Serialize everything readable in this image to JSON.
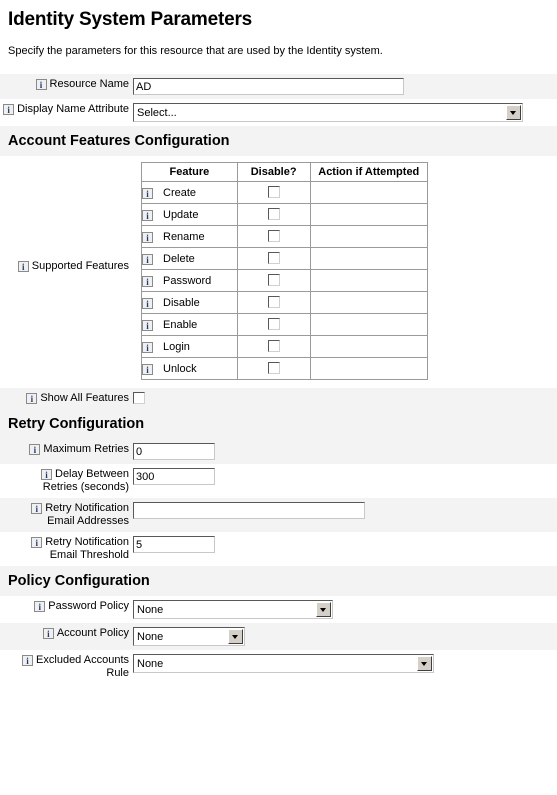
{
  "page": {
    "title": "Identity System Parameters",
    "subtitle": "Specify the parameters for this resource that are used by the Identity system."
  },
  "fields": {
    "resource_name": {
      "label": "Resource Name",
      "value": "AD"
    },
    "display_name_attribute": {
      "label": "Display Name Attribute",
      "value": "Select..."
    },
    "supported_features": {
      "label": "Supported Features"
    },
    "show_all_features": {
      "label": "Show All Features",
      "checked": false
    }
  },
  "sections": {
    "account_features": "Account Features Configuration",
    "retry": "Retry Configuration",
    "policy": "Policy Configuration"
  },
  "features_table": {
    "columns": [
      "Feature",
      "Disable?",
      "Action if Attempted"
    ],
    "rows": [
      {
        "feature": "Create",
        "disabled": false,
        "action": ""
      },
      {
        "feature": "Update",
        "disabled": false,
        "action": ""
      },
      {
        "feature": "Rename",
        "disabled": false,
        "action": ""
      },
      {
        "feature": "Delete",
        "disabled": false,
        "action": ""
      },
      {
        "feature": "Password",
        "disabled": false,
        "action": ""
      },
      {
        "feature": "Disable",
        "disabled": false,
        "action": ""
      },
      {
        "feature": "Enable",
        "disabled": false,
        "action": ""
      },
      {
        "feature": "Login",
        "disabled": false,
        "action": ""
      },
      {
        "feature": "Unlock",
        "disabled": false,
        "action": ""
      }
    ]
  },
  "retry": {
    "maximum_retries": {
      "label": "Maximum Retries",
      "value": "0"
    },
    "delay_between_retries": {
      "label": "Delay Between Retries (seconds)",
      "label_line1": "Delay Between",
      "label_line2": "Retries (seconds)",
      "value": "300"
    },
    "retry_notification_email_addresses": {
      "label": "Retry Notification Email Addresses",
      "label_line1": "Retry Notification",
      "label_line2": "Email Addresses",
      "value": ""
    },
    "retry_notification_email_threshold": {
      "label": "Retry Notification Email Threshold",
      "label_line1": "Retry Notification",
      "label_line2": "Email Threshold",
      "value": "5"
    }
  },
  "policy": {
    "password_policy": {
      "label": "Password Policy",
      "value": "None"
    },
    "account_policy": {
      "label": "Account Policy",
      "value": "None"
    },
    "excluded_accounts_rule": {
      "label": "Excluded Accounts Rule",
      "label_line1": "Excluded Accounts",
      "label_line2": "Rule",
      "value": "None"
    }
  },
  "icons": {
    "info": "i"
  }
}
